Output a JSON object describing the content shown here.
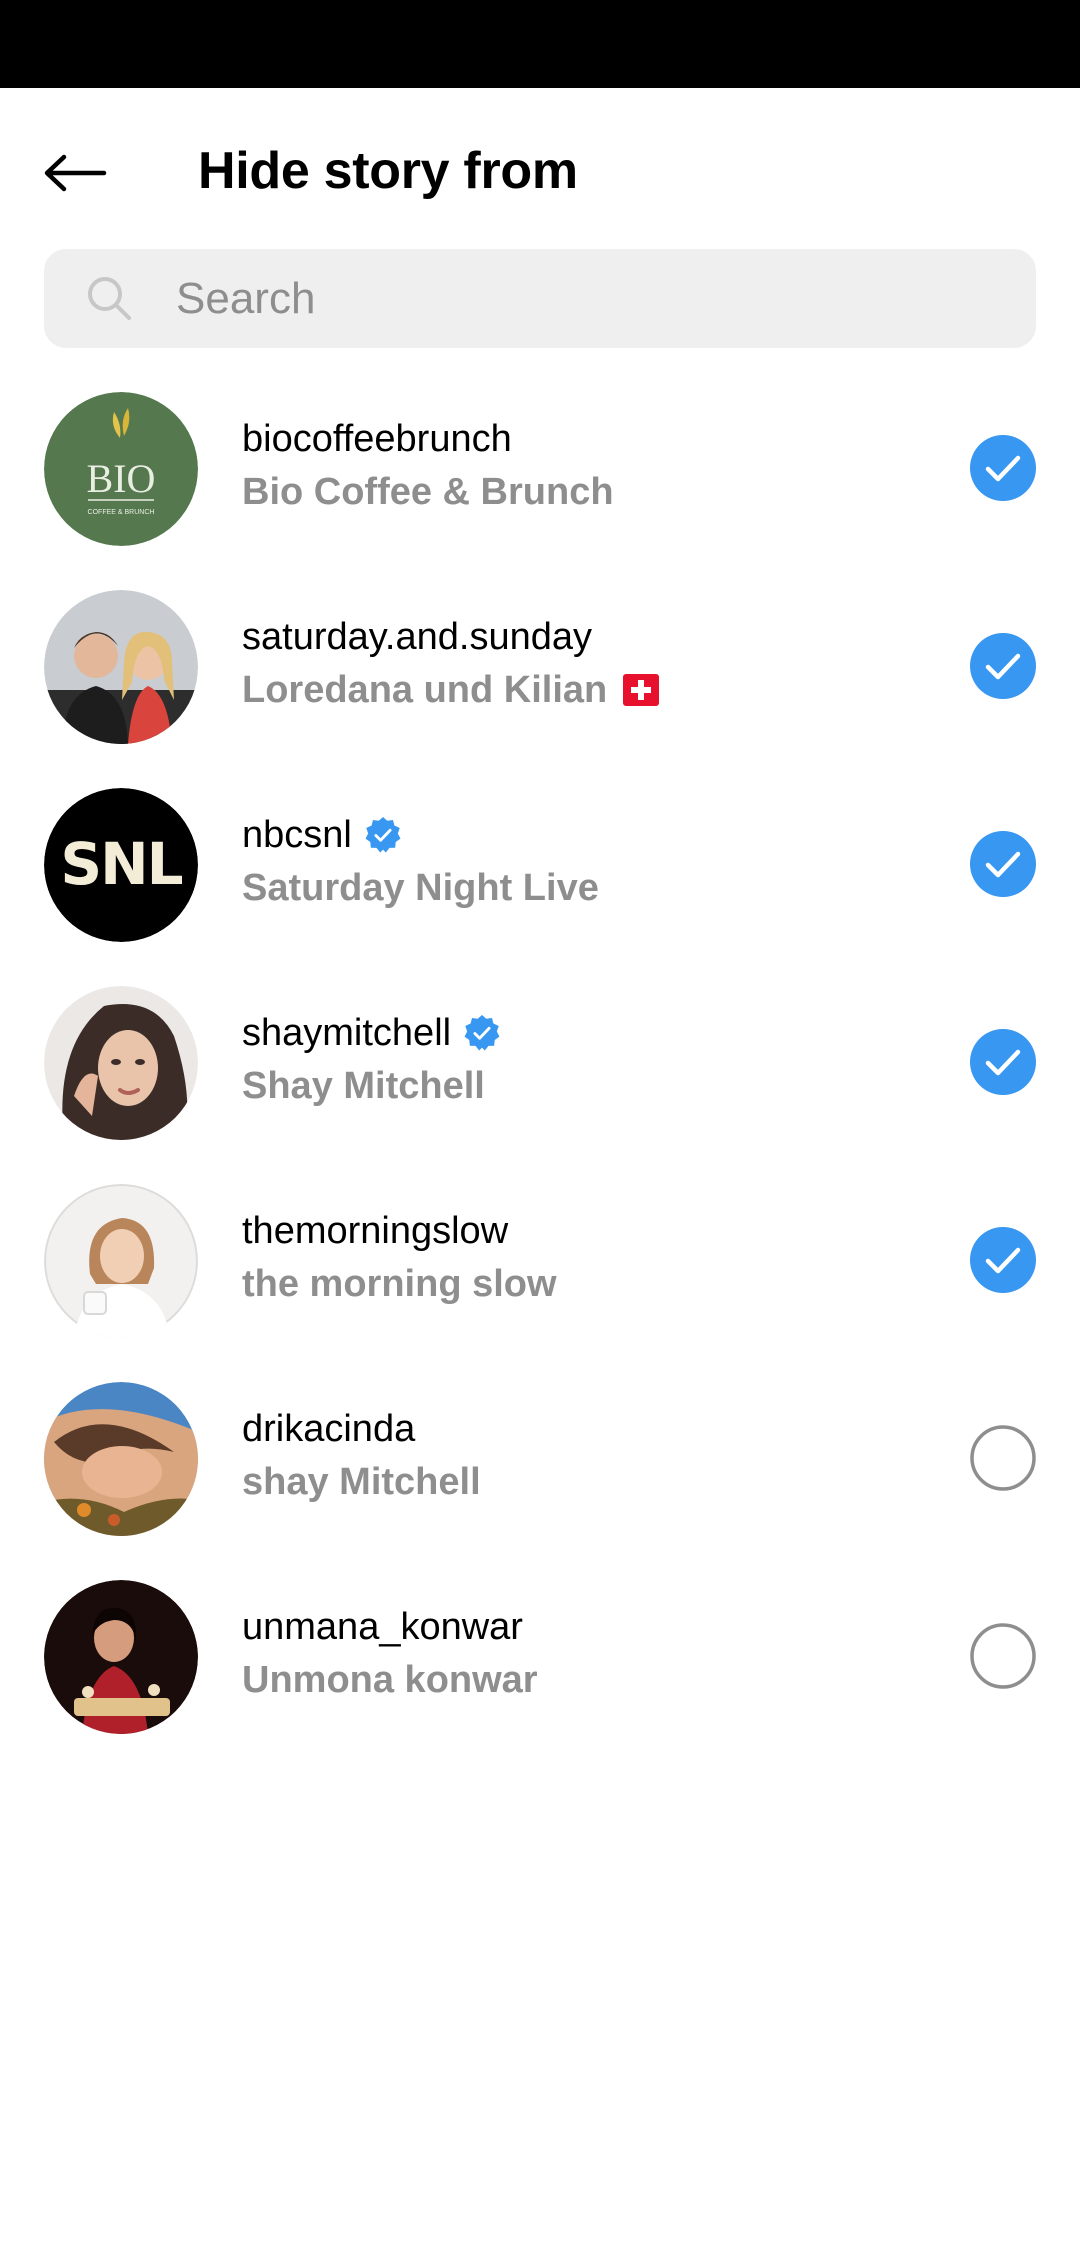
{
  "header": {
    "title": "Hide story from"
  },
  "search": {
    "placeholder": "Search"
  },
  "colors": {
    "accent": "#3897f0",
    "secondary_text": "#8e8e8e",
    "search_bg": "#efefef"
  },
  "accounts": [
    {
      "username": "biocoffeebrunch",
      "full_name": "Bio Coffee & Brunch",
      "selected": true,
      "verified": false,
      "avatar_text": "BIO",
      "avatar_subtext": "COFFEE & BRUNCH"
    },
    {
      "username": "saturday.and.sunday",
      "full_name": "Loredana und Kilian",
      "selected": true,
      "verified": false,
      "flag": "swiss-flag-icon"
    },
    {
      "username": "nbcsnl",
      "full_name": "Saturday Night Live",
      "selected": true,
      "verified": true,
      "avatar_text": "SNL"
    },
    {
      "username": "shaymitchell",
      "full_name": "Shay Mitchell",
      "selected": true,
      "verified": true
    },
    {
      "username": "themorningslow",
      "full_name": "the morning slow",
      "selected": true,
      "verified": false
    },
    {
      "username": "drikacinda",
      "full_name": "shay Mitchell",
      "selected": false,
      "verified": false
    },
    {
      "username": "unmana_konwar",
      "full_name": "Unmona konwar",
      "selected": false,
      "verified": false
    }
  ]
}
